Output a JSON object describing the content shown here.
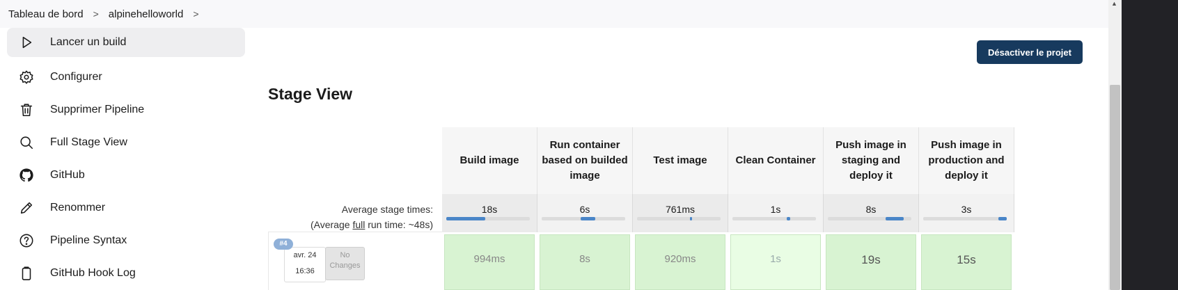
{
  "breadcrumb": {
    "items": [
      "Tableau de bord",
      "alpinehelloworld"
    ],
    "separator": ">"
  },
  "sidebar": {
    "items": [
      {
        "label": "Lancer un build",
        "icon": "play-icon",
        "active": true
      },
      {
        "label": "Configurer",
        "icon": "gear-icon"
      },
      {
        "label": "Supprimer Pipeline",
        "icon": "trash-icon"
      },
      {
        "label": "Full Stage View",
        "icon": "search-icon"
      },
      {
        "label": "GitHub",
        "icon": "github-icon"
      },
      {
        "label": "Renommer",
        "icon": "pencil-icon"
      },
      {
        "label": "Pipeline Syntax",
        "icon": "help-circle-icon"
      },
      {
        "label": "GitHub Hook Log",
        "icon": "clipboard-icon"
      }
    ]
  },
  "actions": {
    "disable_label": "Désactiver le projet"
  },
  "stage_view": {
    "title": "Stage View",
    "avg_label_line1": "Average stage times:",
    "avg_label_prefix": "(Average ",
    "avg_label_link": "full",
    "avg_label_suffix": " run time: ~48s)",
    "stages": [
      {
        "name": "Build image",
        "avg": "18s",
        "bar": 0.47,
        "run": "994ms"
      },
      {
        "name": "Run container based on builded image",
        "avg": "6s",
        "bar": 0.18,
        "run": "8s"
      },
      {
        "name": "Test image",
        "avg": "761ms",
        "bar": 0.03,
        "run": "920ms"
      },
      {
        "name": "Clean Container",
        "avg": "1s",
        "bar": 0.04,
        "run": "1s"
      },
      {
        "name": "Push image in staging and deploy it",
        "avg": "8s",
        "bar": 0.22,
        "run": "19s"
      },
      {
        "name": "Push image in production and deploy it",
        "avg": "3s",
        "bar": 0.1,
        "run": "15s"
      }
    ],
    "run": {
      "number": "#4",
      "date": "avr. 24",
      "time": "16:36",
      "changes": "No Changes"
    }
  },
  "colors": {
    "accent_button": "#173a5e",
    "success_cell": "#d8f3d2",
    "bar_fill": "#4a86c8"
  }
}
